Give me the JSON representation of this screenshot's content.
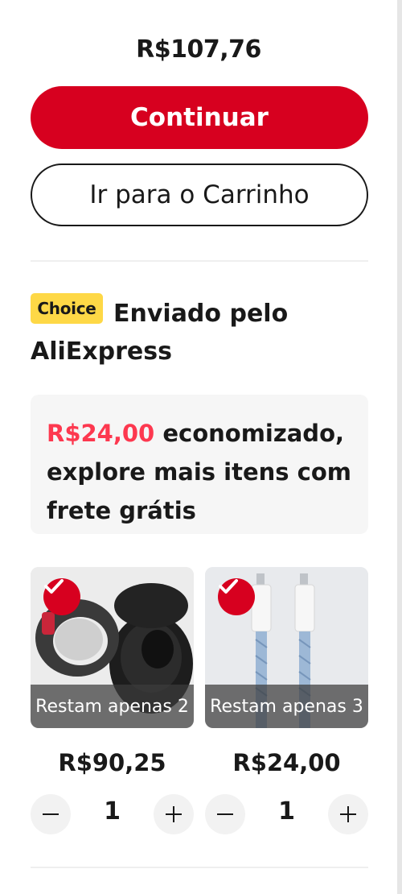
{
  "summary": {
    "total": "R$107,76",
    "continue_label": "Continuar",
    "cart_label": "Ir para o Carrinho"
  },
  "shipping": {
    "badge": "Choice",
    "title_line1": "Enviado pelo",
    "title_line2": "AliExpress"
  },
  "promo": {
    "amount": "R$24,00",
    "text_line1": " economizado,",
    "text_line2": "explore mais itens com",
    "text_line3": "frete grátis"
  },
  "products": [
    {
      "image": "smart-ring-earbuds-image",
      "stock": "Restam apenas 2",
      "price": "R$90,25",
      "quantity": "1",
      "selected": true
    },
    {
      "image": "usb-c-cable-image",
      "stock": "Restam apenas 3",
      "price": "R$24,00",
      "quantity": "1",
      "selected": true
    }
  ],
  "colors": {
    "primary": "#d7001f",
    "promo_amount": "#fd384f",
    "choice_badge": "#fed846"
  }
}
